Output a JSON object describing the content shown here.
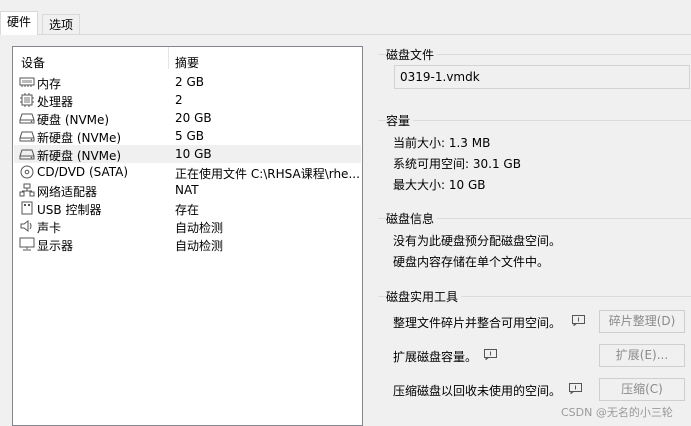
{
  "tabs": [
    {
      "label": "硬件",
      "active": true
    },
    {
      "label": "选项",
      "active": false
    }
  ],
  "device_list": {
    "columns": [
      "设备",
      "摘要"
    ],
    "selected_index": 4,
    "rows": [
      {
        "icon": "memory-icon",
        "device": "内存",
        "summary": "2 GB"
      },
      {
        "icon": "processor-icon",
        "device": "处理器",
        "summary": "2"
      },
      {
        "icon": "hard-disk-icon",
        "device": "硬盘 (NVMe)",
        "summary": "20 GB"
      },
      {
        "icon": "hard-disk-icon",
        "device": "新硬盘 (NVMe)",
        "summary": "5 GB"
      },
      {
        "icon": "hard-disk-icon",
        "device": "新硬盘 (NVMe)",
        "summary": "10 GB"
      },
      {
        "icon": "cd-dvd-icon",
        "device": "CD/DVD (SATA)",
        "summary": "正在使用文件 C:\\RHSA课程\\rhe..."
      },
      {
        "icon": "network-adapter-icon",
        "device": "网络适配器",
        "summary": "NAT"
      },
      {
        "icon": "usb-icon",
        "device": "USB 控制器",
        "summary": "存在"
      },
      {
        "icon": "sound-card-icon",
        "device": "声卡",
        "summary": "自动检测"
      },
      {
        "icon": "display-icon",
        "device": "显示器",
        "summary": "自动检测"
      }
    ]
  },
  "disk_file": {
    "title": "磁盘文件",
    "value": "0319-1.vmdk"
  },
  "capacity": {
    "title": "容量",
    "current_size": "当前大小: 1.3 MB",
    "available": "系统可用空间: 30.1 GB",
    "max_size": "最大大小: 10 GB"
  },
  "disk_info": {
    "title": "磁盘信息",
    "line1": "没有为此硬盘预分配磁盘空间。",
    "line2": "硬盘内容存储在单个文件中。"
  },
  "utilities": {
    "title": "磁盘实用工具",
    "defrag_text": "整理文件碎片并整合可用空间。",
    "defrag_button": "碎片整理(D)",
    "expand_text": "扩展磁盘容量。",
    "expand_button": "扩展(E)...",
    "compact_text": "压缩磁盘以回收未使用的空间。",
    "compact_button": "压缩(C)"
  },
  "watermark": "CSDN @无名的小三轮"
}
